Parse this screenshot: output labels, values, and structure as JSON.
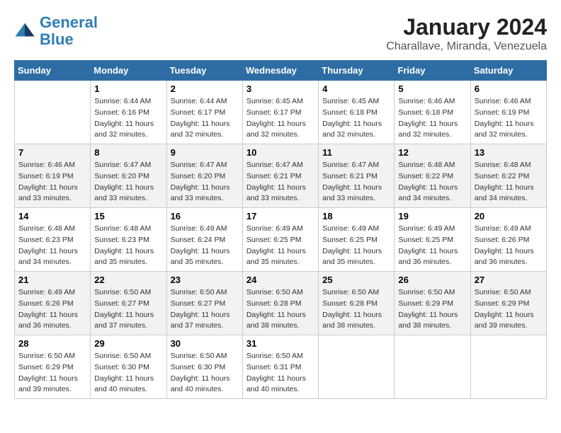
{
  "header": {
    "logo_line1": "General",
    "logo_line2": "Blue",
    "title": "January 2024",
    "subtitle": "Charallave, Miranda, Venezuela"
  },
  "days_of_week": [
    "Sunday",
    "Monday",
    "Tuesday",
    "Wednesday",
    "Thursday",
    "Friday",
    "Saturday"
  ],
  "weeks": [
    [
      {
        "day": "",
        "empty": true
      },
      {
        "day": "1",
        "sunrise": "6:44 AM",
        "sunset": "6:16 PM",
        "daylight": "11 hours and 32 minutes."
      },
      {
        "day": "2",
        "sunrise": "6:44 AM",
        "sunset": "6:17 PM",
        "daylight": "11 hours and 32 minutes."
      },
      {
        "day": "3",
        "sunrise": "6:45 AM",
        "sunset": "6:17 PM",
        "daylight": "11 hours and 32 minutes."
      },
      {
        "day": "4",
        "sunrise": "6:45 AM",
        "sunset": "6:18 PM",
        "daylight": "11 hours and 32 minutes."
      },
      {
        "day": "5",
        "sunrise": "6:46 AM",
        "sunset": "6:18 PM",
        "daylight": "11 hours and 32 minutes."
      },
      {
        "day": "6",
        "sunrise": "6:46 AM",
        "sunset": "6:19 PM",
        "daylight": "11 hours and 32 minutes."
      }
    ],
    [
      {
        "day": "7",
        "sunrise": "6:46 AM",
        "sunset": "6:19 PM",
        "daylight": "11 hours and 33 minutes."
      },
      {
        "day": "8",
        "sunrise": "6:47 AM",
        "sunset": "6:20 PM",
        "daylight": "11 hours and 33 minutes."
      },
      {
        "day": "9",
        "sunrise": "6:47 AM",
        "sunset": "6:20 PM",
        "daylight": "11 hours and 33 minutes."
      },
      {
        "day": "10",
        "sunrise": "6:47 AM",
        "sunset": "6:21 PM",
        "daylight": "11 hours and 33 minutes."
      },
      {
        "day": "11",
        "sunrise": "6:47 AM",
        "sunset": "6:21 PM",
        "daylight": "11 hours and 33 minutes."
      },
      {
        "day": "12",
        "sunrise": "6:48 AM",
        "sunset": "6:22 PM",
        "daylight": "11 hours and 34 minutes."
      },
      {
        "day": "13",
        "sunrise": "6:48 AM",
        "sunset": "6:22 PM",
        "daylight": "11 hours and 34 minutes."
      }
    ],
    [
      {
        "day": "14",
        "sunrise": "6:48 AM",
        "sunset": "6:23 PM",
        "daylight": "11 hours and 34 minutes."
      },
      {
        "day": "15",
        "sunrise": "6:48 AM",
        "sunset": "6:23 PM",
        "daylight": "11 hours and 35 minutes."
      },
      {
        "day": "16",
        "sunrise": "6:49 AM",
        "sunset": "6:24 PM",
        "daylight": "11 hours and 35 minutes."
      },
      {
        "day": "17",
        "sunrise": "6:49 AM",
        "sunset": "6:25 PM",
        "daylight": "11 hours and 35 minutes."
      },
      {
        "day": "18",
        "sunrise": "6:49 AM",
        "sunset": "6:25 PM",
        "daylight": "11 hours and 35 minutes."
      },
      {
        "day": "19",
        "sunrise": "6:49 AM",
        "sunset": "6:25 PM",
        "daylight": "11 hours and 36 minutes."
      },
      {
        "day": "20",
        "sunrise": "6:49 AM",
        "sunset": "6:26 PM",
        "daylight": "11 hours and 36 minutes."
      }
    ],
    [
      {
        "day": "21",
        "sunrise": "6:49 AM",
        "sunset": "6:26 PM",
        "daylight": "11 hours and 36 minutes."
      },
      {
        "day": "22",
        "sunrise": "6:50 AM",
        "sunset": "6:27 PM",
        "daylight": "11 hours and 37 minutes."
      },
      {
        "day": "23",
        "sunrise": "6:50 AM",
        "sunset": "6:27 PM",
        "daylight": "11 hours and 37 minutes."
      },
      {
        "day": "24",
        "sunrise": "6:50 AM",
        "sunset": "6:28 PM",
        "daylight": "11 hours and 38 minutes."
      },
      {
        "day": "25",
        "sunrise": "6:50 AM",
        "sunset": "6:28 PM",
        "daylight": "11 hours and 38 minutes."
      },
      {
        "day": "26",
        "sunrise": "6:50 AM",
        "sunset": "6:29 PM",
        "daylight": "11 hours and 38 minutes."
      },
      {
        "day": "27",
        "sunrise": "6:50 AM",
        "sunset": "6:29 PM",
        "daylight": "11 hours and 39 minutes."
      }
    ],
    [
      {
        "day": "28",
        "sunrise": "6:50 AM",
        "sunset": "6:29 PM",
        "daylight": "11 hours and 39 minutes."
      },
      {
        "day": "29",
        "sunrise": "6:50 AM",
        "sunset": "6:30 PM",
        "daylight": "11 hours and 40 minutes."
      },
      {
        "day": "30",
        "sunrise": "6:50 AM",
        "sunset": "6:30 PM",
        "daylight": "11 hours and 40 minutes."
      },
      {
        "day": "31",
        "sunrise": "6:50 AM",
        "sunset": "6:31 PM",
        "daylight": "11 hours and 40 minutes."
      },
      {
        "day": "",
        "empty": true
      },
      {
        "day": "",
        "empty": true
      },
      {
        "day": "",
        "empty": true
      }
    ]
  ],
  "labels": {
    "sunrise": "Sunrise:",
    "sunset": "Sunset:",
    "daylight": "Daylight:"
  }
}
